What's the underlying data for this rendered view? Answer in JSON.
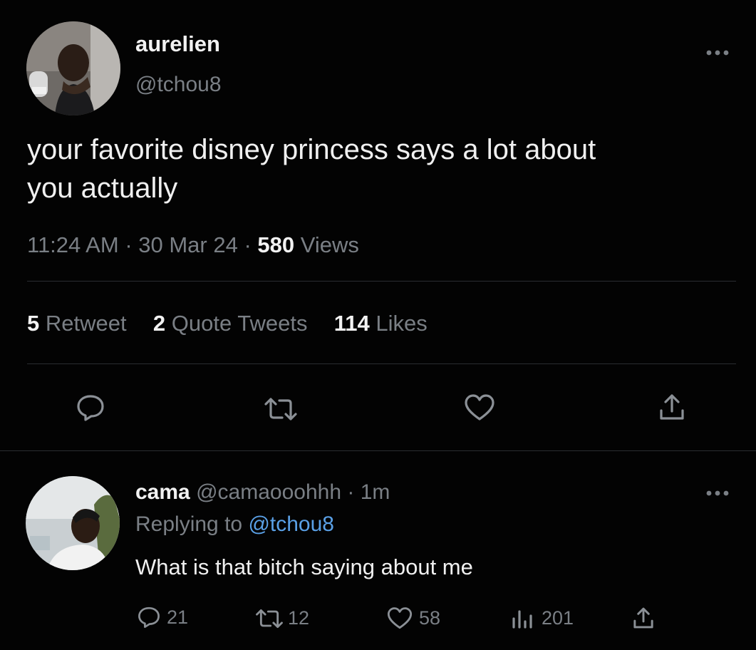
{
  "tweet": {
    "author_name": "aurelien",
    "author_handle": "@tchou8",
    "text_line1": "your favorite disney princess says a lot about",
    "text_line2": "you actually",
    "time": "11:24 AM",
    "sep1": "·",
    "date": "30 Mar 24",
    "sep2": "·",
    "views_count": "580",
    "views_label": "Views",
    "retweets_count": "5",
    "retweets_label": "Retweet",
    "quotes_count": "2",
    "quotes_label": "Quote Tweets",
    "likes_count": "114",
    "likes_label": "Likes"
  },
  "reply": {
    "author_name": "cama",
    "author_handle": "@camaooohhh",
    "sep": "·",
    "age": "1m",
    "replying_prefix": "Replying to",
    "replying_handle": "@tchou8",
    "text": "What is that bitch saying about me",
    "reply_count": "21",
    "retweet_count": "12",
    "like_count": "58",
    "views_count": "201"
  },
  "icons": {
    "more": "more-horizontal-icon",
    "reply": "speech-bubble-icon",
    "retweet": "retweet-arrows-icon",
    "like": "heart-outline-icon",
    "share": "share-upload-icon",
    "views": "bar-chart-icon"
  },
  "colors": {
    "background": "#030303",
    "text": "#e8e8e8",
    "muted": "#7a7f85",
    "link": "#5aa0e6",
    "divider": "#2a2d31"
  }
}
